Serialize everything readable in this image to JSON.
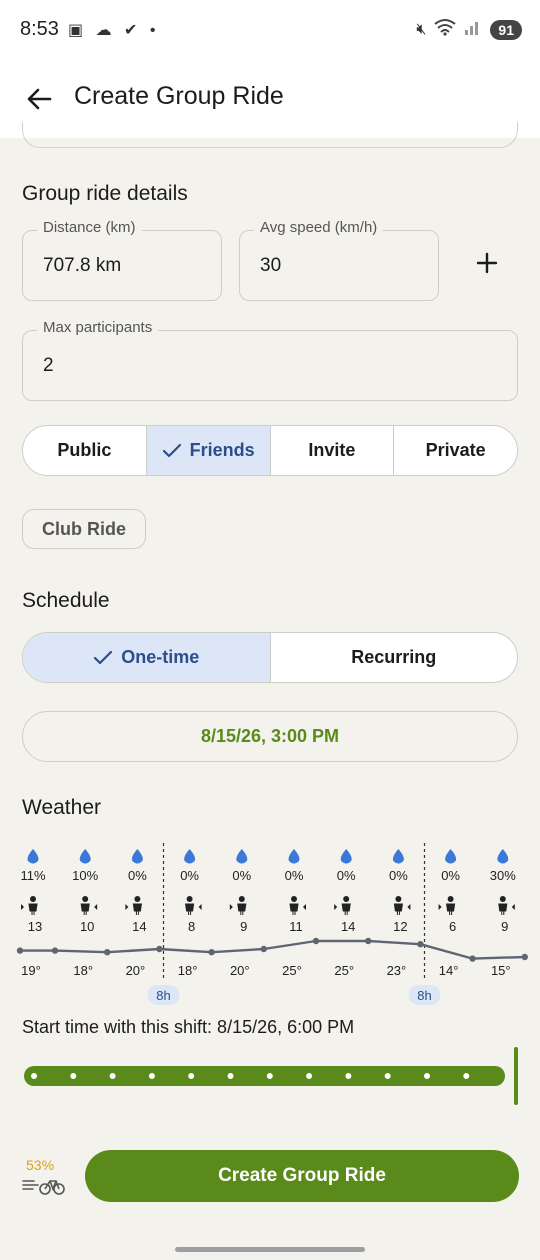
{
  "status_bar": {
    "time": "8:53",
    "left_icons": "▣ ☁ ✔ •",
    "battery": "91"
  },
  "app_bar": {
    "title": "Create Group Ride"
  },
  "details": {
    "section_title": "Group ride details",
    "distance_label": "Distance (km)",
    "distance_value": "707.8 km",
    "speed_label": "Avg speed (km/h)",
    "speed_value": "30",
    "participants_label": "Max participants",
    "participants_value": "2"
  },
  "visibility": {
    "options": [
      "Public",
      "Friends",
      "Invite",
      "Private"
    ],
    "selected": "Friends"
  },
  "club_chip": "Club Ride",
  "schedule": {
    "section_title": "Schedule",
    "options": [
      "One-time",
      "Recurring"
    ],
    "selected": "One-time",
    "datetime": "8/15/26, 3:00 PM"
  },
  "weather": {
    "section_title": "Weather",
    "hours": [
      {
        "rain": "11%",
        "wind": "13",
        "temp": "19°",
        "temp_value": 19
      },
      {
        "rain": "10%",
        "wind": "10",
        "temp": "18°",
        "temp_value": 18
      },
      {
        "rain": "0%",
        "wind": "14",
        "temp": "20°",
        "temp_value": 20
      },
      {
        "rain": "0%",
        "wind": "8",
        "temp": "18°",
        "temp_value": 18
      },
      {
        "rain": "0%",
        "wind": "9",
        "temp": "20°",
        "temp_value": 20
      },
      {
        "rain": "0%",
        "wind": "11",
        "temp": "25°",
        "temp_value": 25
      },
      {
        "rain": "0%",
        "wind": "14",
        "temp": "25°",
        "temp_value": 25
      },
      {
        "rain": "0%",
        "wind": "12",
        "temp": "23°",
        "temp_value": 23
      },
      {
        "rain": "0%",
        "wind": "6",
        "temp": "14°",
        "temp_value": 14
      },
      {
        "rain": "30%",
        "wind": "9",
        "temp": "15°",
        "temp_value": 15
      }
    ],
    "markers": [
      {
        "label": "8h",
        "after_index": 2
      },
      {
        "label": "8h",
        "after_index": 7
      }
    ]
  },
  "shift": {
    "text": "Start time with this shift: 8/15/26, 6:00 PM",
    "steps": 13,
    "position": 1.0
  },
  "footer": {
    "percent": "53%",
    "cta_label": "Create Group Ride"
  },
  "colors": {
    "accent_green": "#5a8a1a",
    "selected_blue": "#dce6f7",
    "rain_blue": "#3b78d8",
    "temp_line": "#5f6672"
  }
}
